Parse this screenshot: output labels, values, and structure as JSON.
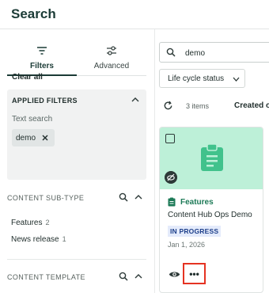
{
  "header": {
    "title": "Search"
  },
  "tabs": [
    {
      "label": "Filters",
      "icon": "filter-icon",
      "active": true
    },
    {
      "label": "Advanced",
      "icon": "sliders-icon",
      "active": false
    }
  ],
  "applied_filters": {
    "title": "APPLIED FILTERS",
    "text_search_label": "Text search",
    "chip_value": "demo",
    "clear_all": "Clear all"
  },
  "sections": {
    "content_subtype": {
      "title": "CONTENT SUB-TYPE",
      "items": [
        {
          "label": "Features",
          "count": "2"
        },
        {
          "label": "News release",
          "count": "1"
        }
      ]
    },
    "content_template": {
      "title": "CONTENT TEMPLATE"
    }
  },
  "search": {
    "value": "demo"
  },
  "lifecycle_filter": {
    "label": "Life cycle status"
  },
  "results": {
    "count_text": "3 items",
    "sort_label": "Created o"
  },
  "card": {
    "type_label": "Features",
    "title": "Content Hub Ops Demo",
    "status": "IN PROGRESS",
    "date": "Jan 1, 2026",
    "more_label": "•••"
  },
  "colors": {
    "accent": "#1b3b36",
    "thumbnail": "#bdf0d8",
    "type_green": "#1d7a57",
    "status_bg": "#e4ebfb",
    "status_text": "#1d3f8a",
    "highlight": "#e53322"
  }
}
